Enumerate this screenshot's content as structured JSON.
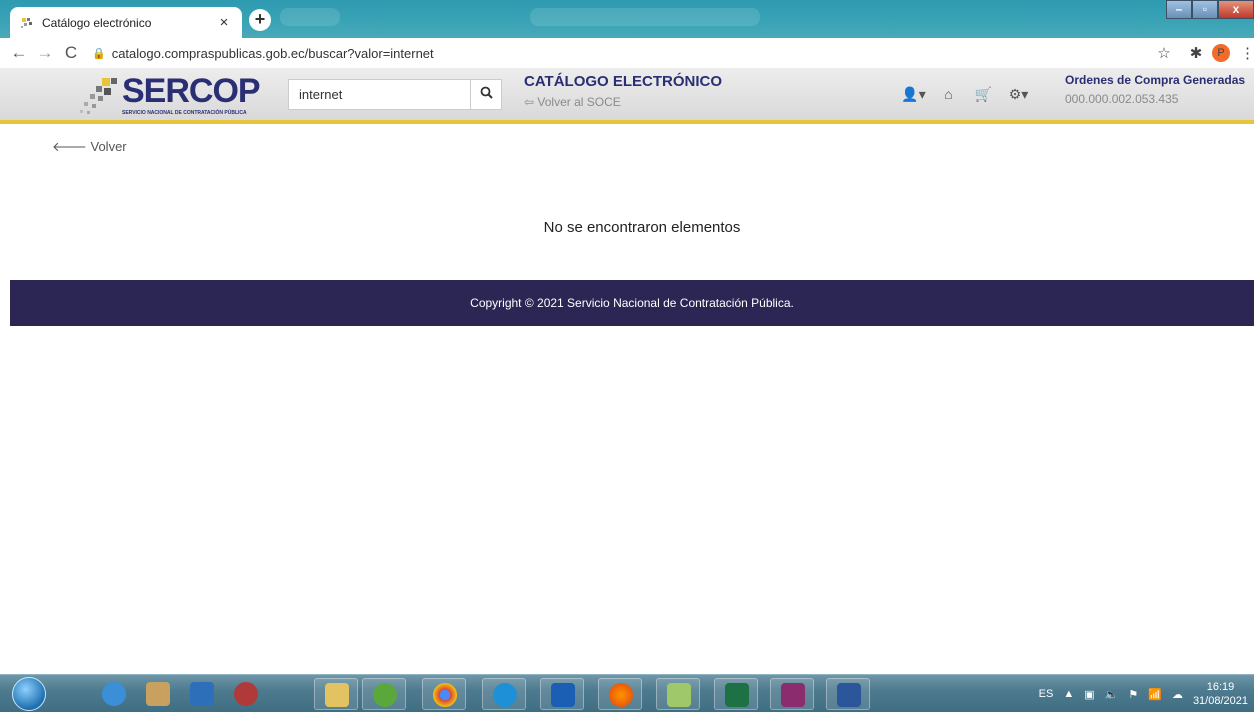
{
  "browser": {
    "tab_title": "Catálogo electrónico",
    "tab_close": "×",
    "new_tab": "+",
    "url": "catalogo.compraspublicas.gob.ec/buscar?valor=internet",
    "profile_initial": "P"
  },
  "header": {
    "logo_text": "SERCOP",
    "logo_subtitle": "SERVICIO NACIONAL DE CONTRATACIÓN PÚBLICA",
    "search_value": "internet",
    "catalog_title": "CATÁLOGO ELECTRÓNICO",
    "back_to_soce": "Volver al SOCE",
    "orders_label": "Ordenes de Compra Generadas",
    "orders_value": "000.000.002.053.435"
  },
  "main": {
    "back_label": "Volver",
    "empty_message": "No se encontraron elementos"
  },
  "footer": {
    "copyright": "Copyright © 2021 Servicio Nacional de Contratación Pública."
  },
  "taskbar": {
    "language": "ES",
    "time": "16:19",
    "date": "31/08/2021"
  },
  "colors": {
    "brand_navy": "#2a2f73",
    "footer_bg": "#2b2654",
    "header_accent": "#e8c43a"
  }
}
